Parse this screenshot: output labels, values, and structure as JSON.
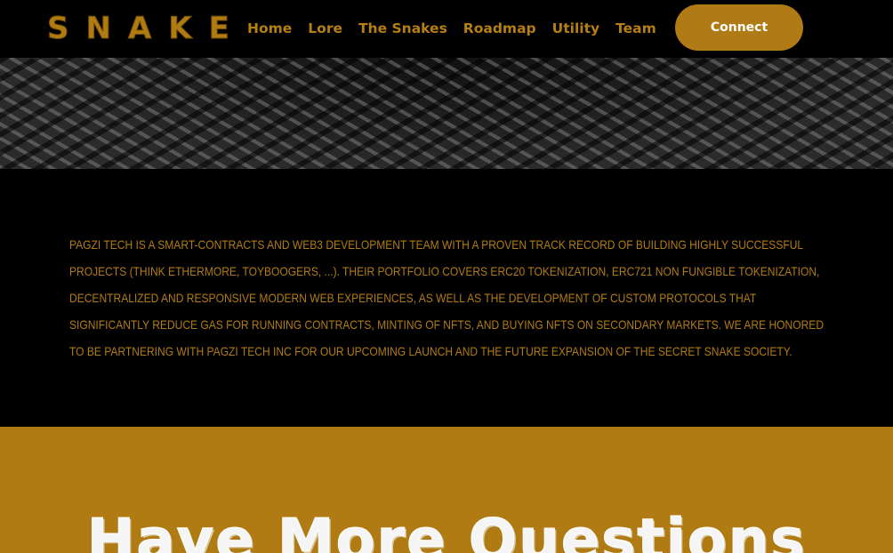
{
  "nav": {
    "logo": "SNAKE",
    "links": [
      "Home",
      "Lore",
      "The Snakes",
      "Roadmap",
      "Utility",
      "Team"
    ],
    "connect_label": "Connect"
  },
  "info": {
    "text": "Pagzi Tech is a smart-contracts and web3 development team with a proven track record of building highly successful projects (think Ethermore, Toyboogers, ...). Their portfolio covers ERC20 tokenization, ERC721 non fungible tokenization, decentralized and responsive modern web experiences, as well as the development of custom protocols that significantly reduce gas for running contracts, minting of NFTs, and buying NFTs on secondary markets. We are honored to be partnering with Pagzi Tech Inc for our upcoming launch and the future expansion of the Secret Snake Society."
  },
  "questions": {
    "title": "Have More Questions"
  },
  "colors": {
    "accent": "#b07b13",
    "background": "#000000",
    "text_light": "#ffffff"
  }
}
